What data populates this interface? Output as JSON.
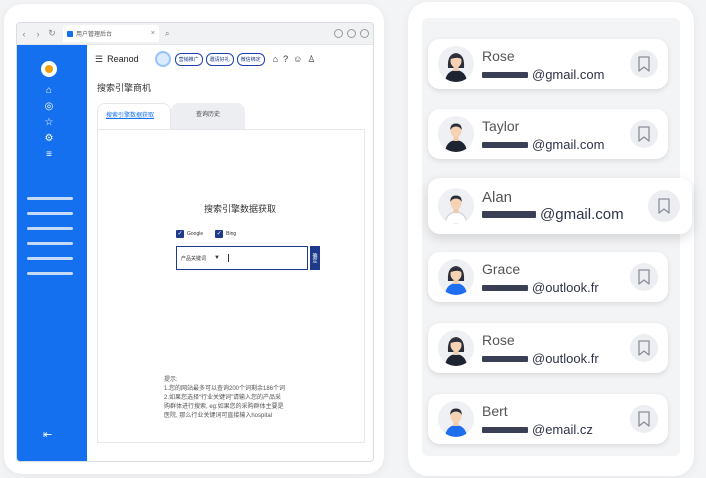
{
  "browser": {
    "tab_title": "用户管理后台",
    "tab_close": "×"
  },
  "app": {
    "brand": "Reanod",
    "page_title": "搜索引擎商机",
    "pills": [
      "营销推广",
      "邀请好礼",
      "微信绑定"
    ],
    "tabs": [
      "搜索引擎数据获取",
      "查询历史"
    ],
    "panel_title": "搜索引擎数据获取",
    "checkboxes": [
      "Google",
      "Bing"
    ],
    "search_placeholder": "产品关键词",
    "confirm_label": "确定",
    "hint_lines": [
      "提示:",
      "1.您的网站最多可以查询200个词剩余186个词",
      "2.如果您选择“行业关键词”请输入您的产品采",
      "购群体进行搜索, eg:如果您的采购群体主要是",
      "医院, 那么行业关键词可直接输入hospital"
    ]
  },
  "contacts": [
    {
      "name": "Rose",
      "email": "@gmail.com",
      "gender": "female",
      "suit": "#1f2433"
    },
    {
      "name": "Taylor",
      "email": "@gmail.com",
      "gender": "male",
      "suit": "#1f2433"
    },
    {
      "name": "Alan",
      "email": "@gmail.com",
      "gender": "male",
      "suit": "#ffffff"
    },
    {
      "name": "Grace",
      "email": "@outlook.fr",
      "gender": "female",
      "suit": "#1e6ef0"
    },
    {
      "name": "Rose",
      "email": "@outlook.fr",
      "gender": "female",
      "suit": "#1f2433"
    },
    {
      "name": "Bert",
      "email": "@email.cz",
      "gender": "male",
      "suit": "#1e6ef0"
    }
  ],
  "colors": {
    "sidebar": "#1570ef",
    "navy": "#1e3a8a",
    "mask": "#3b3f55"
  }
}
